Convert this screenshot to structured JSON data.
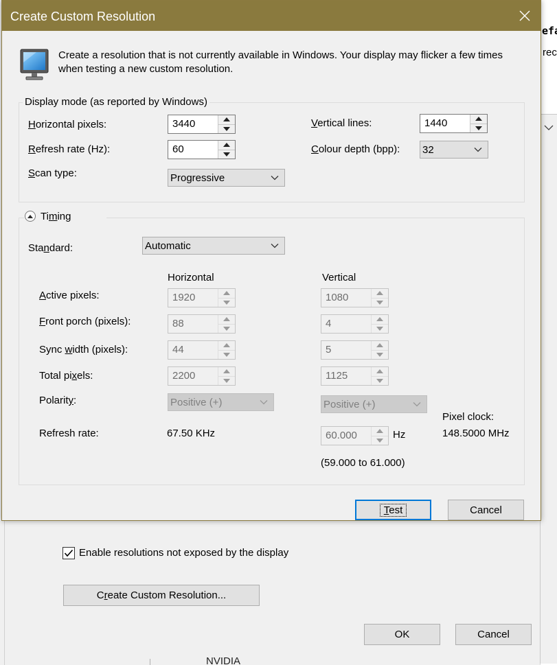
{
  "dialog": {
    "title": "Create Custom Resolution",
    "description": "Create a resolution that is not currently available in Windows. Your display may flicker a few times when testing a new custom resolution.",
    "display_mode": {
      "group_title": "Display mode (as reported by Windows)",
      "horizontal_pixels": {
        "label_accel": "H",
        "label_rest": "orizontal pixels:",
        "value": "3440"
      },
      "vertical_lines": {
        "label_accel": "V",
        "label_rest": "ertical lines:",
        "value": "1440"
      },
      "refresh_rate": {
        "label_accel": "R",
        "label_rest": "efresh rate (Hz):",
        "value": "60"
      },
      "colour_depth": {
        "label_accel": "C",
        "label_rest": "olour depth (bpp):",
        "value": "32"
      },
      "scan_type": {
        "label_accel": "S",
        "label_rest": "can type:",
        "value": "Progressive"
      }
    },
    "timing": {
      "toggle_pre": "Ti",
      "toggle_accel": "m",
      "toggle_post": "ing",
      "standard": {
        "label_pre": "Sta",
        "label_accel": "n",
        "label_post": "dard:",
        "value": "Automatic"
      },
      "col_horizontal": "Horizontal",
      "col_vertical": "Vertical",
      "active_pixels": {
        "label_accel": "A",
        "label_rest": "ctive pixels:",
        "h": "1920",
        "v": "1080"
      },
      "front_porch": {
        "label_accel": "F",
        "label_rest": "ront porch (pixels):",
        "h": "88",
        "v": "4"
      },
      "sync_width": {
        "label_pre": "Sync ",
        "label_accel": "w",
        "label_post": "idth (pixels):",
        "h": "44",
        "v": "5"
      },
      "total_pixels": {
        "label_pre": "Total pi",
        "label_accel": "x",
        "label_post": "els:",
        "h": "2200",
        "v": "1125"
      },
      "polarity": {
        "label_pre": "Polarit",
        "label_accel": "y",
        "label_post": ":",
        "h": "Positive (+)",
        "v": "Positive (+)"
      },
      "refresh_rate": {
        "label": "Refresh rate:",
        "h_value": "67.50 KHz",
        "v_value": "60.000",
        "v_unit": "Hz",
        "range": "(59.000 to 61.000)"
      },
      "pixel_clock": {
        "label": "Pixel clock:",
        "value": "148.5000 MHz"
      }
    },
    "buttons": {
      "test_accel": "T",
      "test_rest": "est",
      "cancel": "Cancel"
    }
  },
  "background": {
    "enable_checkbox_label": "Enable resolutions not exposed by the display",
    "enable_checked": true,
    "create_button_pre": "C",
    "create_button_accel": "r",
    "create_button_post": "eate Custom Resolution...",
    "ok_label": "OK",
    "cancel_label": "Cancel",
    "right_fragment_1": "efa",
    "right_fragment_2": "rec",
    "bottom_fragment": "NVIDIA"
  },
  "colors": {
    "titlebar": "#8a7a3e",
    "dialog_bg": "#f0f0f0",
    "default_button_border": "#0078d7"
  }
}
